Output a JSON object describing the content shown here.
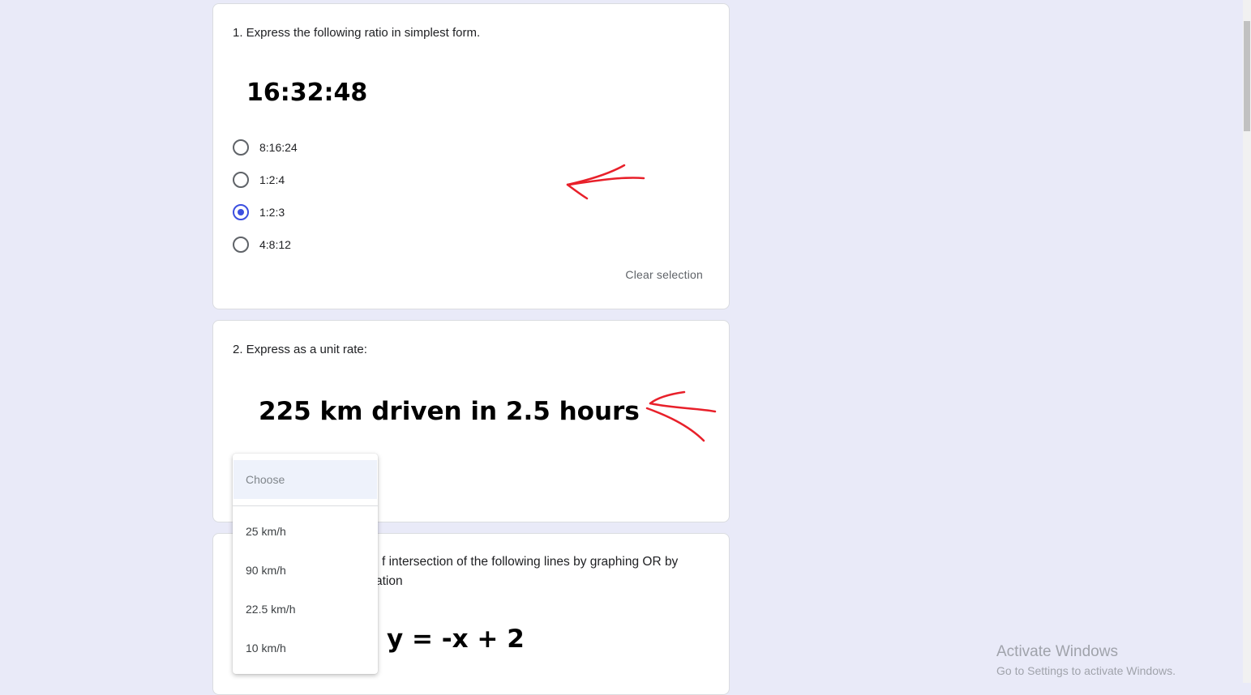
{
  "questions": [
    {
      "title": "1. Express the following ratio in simplest form.",
      "prompt": "16:32:48",
      "options": [
        {
          "label": "8:16:24",
          "selected": false
        },
        {
          "label": "1:2:4",
          "selected": false
        },
        {
          "label": "1:2:3",
          "selected": true
        },
        {
          "label": "4:8:12",
          "selected": false
        }
      ],
      "clear_label": "Clear selection"
    },
    {
      "title": "2. Express as a unit rate:",
      "prompt": "225 km driven in 2.5 hours"
    },
    {
      "title_line1_visible": "f intersection of the following lines by graphing OR by",
      "title_line2_visible": "ation",
      "prompt_visible": "y = -x + 2"
    }
  ],
  "dropdown": {
    "placeholder": "Choose",
    "options": [
      "25 km/h",
      "90 km/h",
      "22.5 km/h",
      "10 km/h"
    ]
  },
  "watermark": {
    "title": "Activate Windows",
    "subtitle": "Go to Settings to activate Windows."
  },
  "colors": {
    "page_bg": "#e9eaf8",
    "radio_accent": "#3c4fe0",
    "annotation": "#e8202a"
  }
}
